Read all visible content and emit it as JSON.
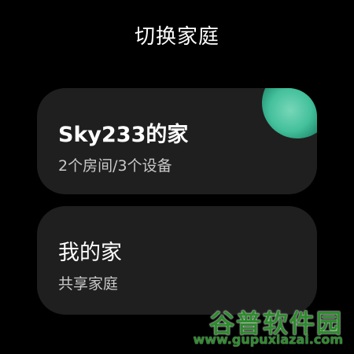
{
  "header": {
    "title": "切换家庭"
  },
  "homes": [
    {
      "name": "Sky233的家",
      "subtitle": "2个房间/3个设备",
      "selected": true
    },
    {
      "name": "我的家",
      "subtitle": "共享家庭",
      "selected": false
    }
  ],
  "colors": {
    "background": "#000000",
    "card": "#1f1f1f",
    "accent": "#46c9a2",
    "text": "#ffffff",
    "subtext": "#c9c9c9"
  },
  "watermark": {
    "brand": "谷普软件园",
    "url": "www.gupuxiazai.com"
  }
}
